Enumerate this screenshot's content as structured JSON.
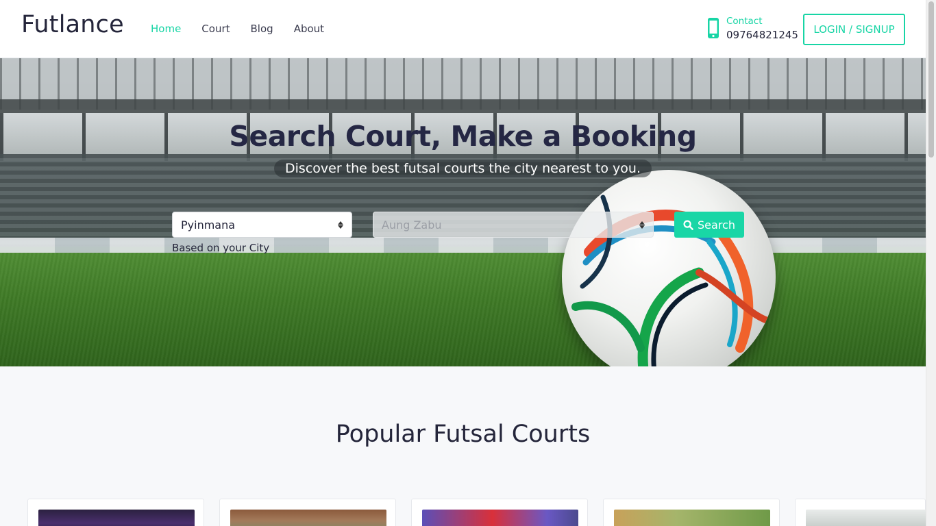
{
  "header": {
    "logo": "Futlance",
    "nav": [
      {
        "label": "Home",
        "active": true
      },
      {
        "label": "Court",
        "active": false
      },
      {
        "label": "Blog",
        "active": false
      },
      {
        "label": "About",
        "active": false
      }
    ],
    "contact_label": "Contact",
    "contact_number": "09764821245",
    "login_label": "LOGIN / SIGNUP"
  },
  "hero": {
    "title": "Search Court, Make a Booking",
    "subtitle": "Discover the best futsal courts the city nearest to you.",
    "city_select_value": "Pyinmana",
    "town_select_value": "Aung Zabu",
    "search_label": "Search",
    "city_hint": "Based on your City"
  },
  "popular": {
    "title": "Popular Futsal Courts"
  },
  "icons": {
    "phone": "phone-icon",
    "search": "search-icon",
    "select_arrows": "sort-arrows-icon"
  },
  "colors": {
    "accent": "#17d5a5",
    "text_dark": "#24253a"
  }
}
